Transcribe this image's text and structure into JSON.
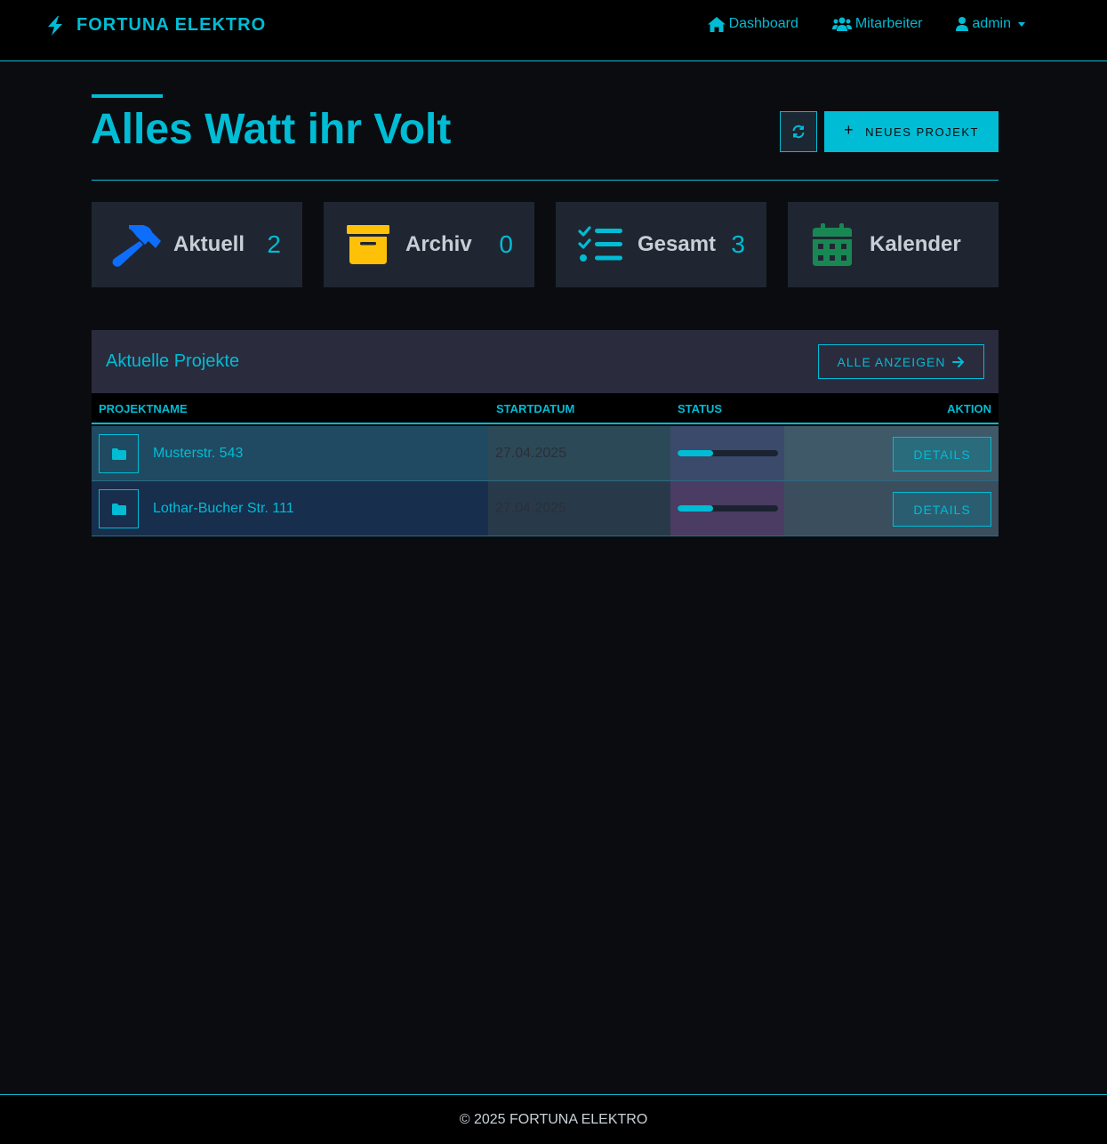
{
  "brand": {
    "name": "FORTUNA ELEKTRO",
    "icon": "bolt-icon"
  },
  "nav": {
    "dashboard": "Dashboard",
    "employees": "Mitarbeiter",
    "user": "admin"
  },
  "header": {
    "title": "Alles Watt ihr Volt",
    "new_project_label": "NEUES PROJEKT"
  },
  "stats": [
    {
      "label": "Aktuell",
      "count": "2",
      "icon": "hammer-icon",
      "color": "#0d6efd"
    },
    {
      "label": "Archiv",
      "count": "0",
      "icon": "archive-box-icon",
      "color": "#ffc107"
    },
    {
      "label": "Gesamt",
      "count": "3",
      "icon": "checklist-icon",
      "color": "#00bcd4"
    },
    {
      "label": "Kalender",
      "icon": "calendar-icon",
      "color": "#198754"
    }
  ],
  "projects": {
    "title": "Aktuelle Projekte",
    "show_all_label": "ALLE ANZEIGEN",
    "columns": [
      "PROJEKTNAME",
      "STARTDATUM",
      "STATUS",
      "AKTION"
    ],
    "rows": [
      {
        "name": "Musterstr. 543",
        "start_date": "27.04.2025",
        "progress": 0.35,
        "action": "DETAILS"
      },
      {
        "name": "Lothar-Bucher Str. 111",
        "start_date": "27.04.2025",
        "progress": 0.35,
        "action": "DETAILS"
      }
    ]
  },
  "footer": {
    "text": "© 2025 FORTUNA ELEKTRO"
  },
  "colors": {
    "accent": "#00bcd4",
    "background": "#0b0c10"
  }
}
